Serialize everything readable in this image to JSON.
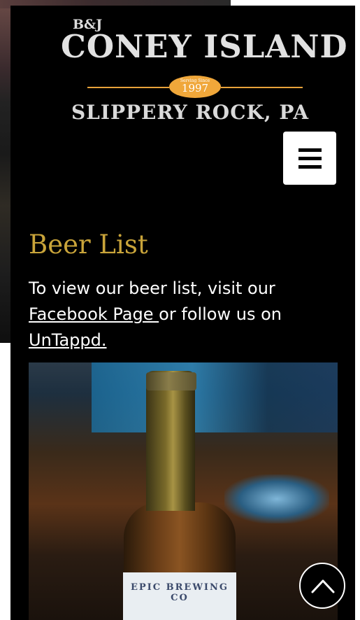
{
  "logo": {
    "prefix": "B&J",
    "title": "CONEY ISLAND",
    "badge_small": "Serving Since",
    "badge_year": "1997",
    "location": "SLIPPERY ROCK, PA",
    "accent_color": "#f0a73a"
  },
  "nav": {
    "menu_icon": "hamburger-menu-icon"
  },
  "content": {
    "heading": "Beer List",
    "intro": "To view our beer list, visit our ",
    "facebook_link": "Facebook Page ",
    "middle": "or follow us on ",
    "untappd_link": "UnTappd."
  },
  "photo": {
    "label_text": "EPIC BREWING CO"
  },
  "scroll_top": {
    "icon": "chevron-up-icon"
  },
  "colors": {
    "heading": "#c9a43a",
    "background": "#000000",
    "text": "#ffffff"
  }
}
